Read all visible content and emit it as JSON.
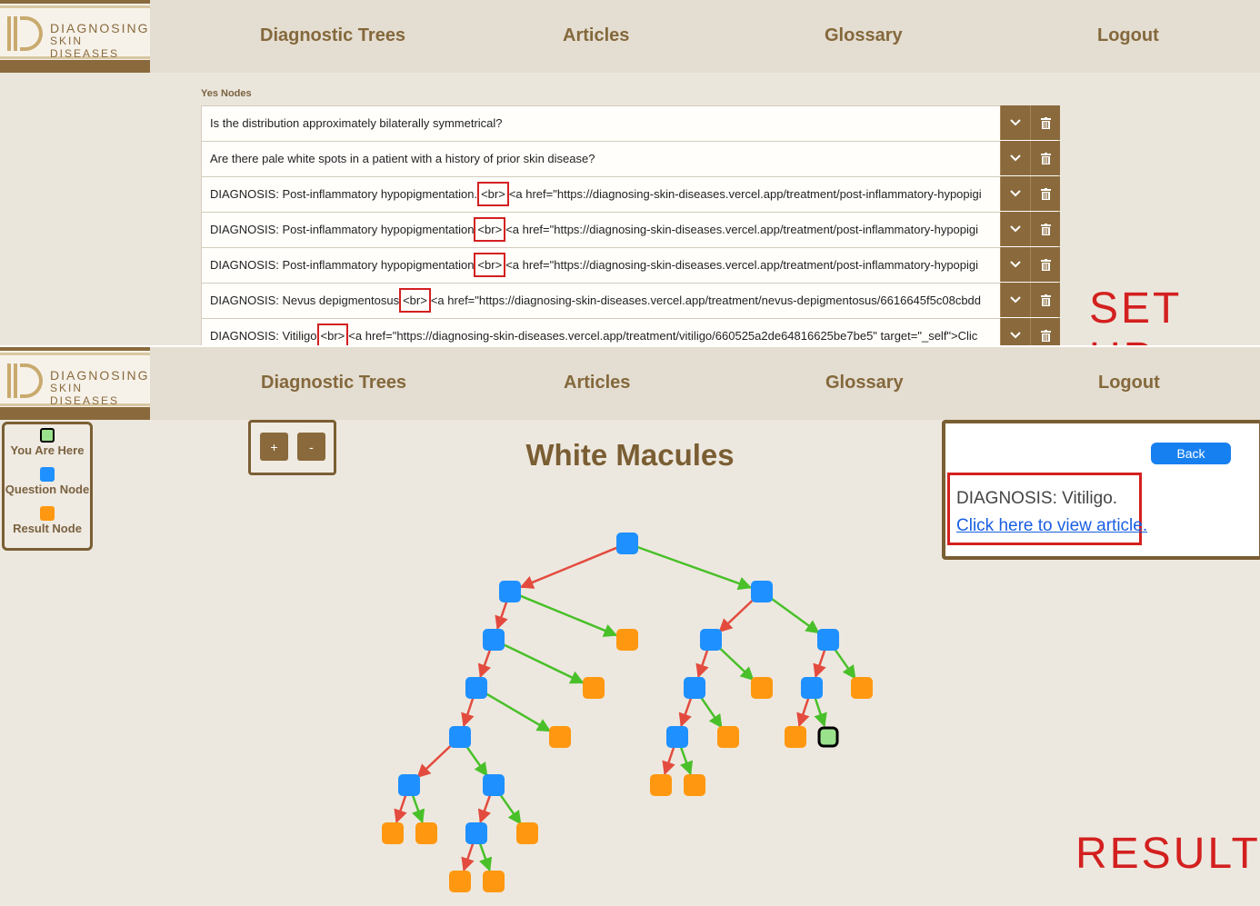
{
  "navbar": {
    "logo_line1": "DIAGNOSING",
    "logo_line2": "SKIN DISEASES",
    "items": [
      {
        "label": "Diagnostic Trees"
      },
      {
        "label": "Articles"
      },
      {
        "label": "Glossary"
      },
      {
        "label": "Logout"
      }
    ]
  },
  "setup": {
    "section_label": "Yes Nodes",
    "rows": [
      {
        "before": "Is the distribution approximately bilaterally symmetrical?",
        "tag": "",
        "after": ""
      },
      {
        "before": "Are there pale white spots in a patient with a history of prior skin disease?",
        "tag": "",
        "after": ""
      },
      {
        "before": "DIAGNOSIS: Post-inflammatory hypopigmentation.",
        "tag": "<br>",
        "after": "<a href=\"https://diagnosing-skin-diseases.vercel.app/treatment/post-inflammatory-hypopigi"
      },
      {
        "before": "DIAGNOSIS: Post-inflammatory hypopigmentation",
        "tag": "<br>",
        "after": "<a href=\"https://diagnosing-skin-diseases.vercel.app/treatment/post-inflammatory-hypopigi"
      },
      {
        "before": "DIAGNOSIS: Post-inflammatory hypopigmentation",
        "tag": "<br>",
        "after": "<a href=\"https://diagnosing-skin-diseases.vercel.app/treatment/post-inflammatory-hypopigi"
      },
      {
        "before": "DIAGNOSIS: Nevus depigmentosus",
        "tag": "<br>",
        "after": "<a href=\"https://diagnosing-skin-diseases.vercel.app/treatment/nevus-depigmentosus/6616645f5c08cbdd"
      },
      {
        "before": "DIAGNOSIS: Vitiligo",
        "tag": "<br>",
        "after": "<a href=\"https://diagnosing-skin-diseases.vercel.app/treatment/vitiligo/660525a2de64816625be7be5\" target=\"_self\">Clic"
      }
    ],
    "label": "SET UP"
  },
  "result": {
    "legend": [
      {
        "label": "You Are Here",
        "icon": "current-node-icon",
        "color": "#000000"
      },
      {
        "label": "Question Node",
        "icon": "question-node-icon",
        "color": "#1e90ff"
      },
      {
        "label": "Result Node",
        "icon": "result-node-icon",
        "color": "#ff9810"
      }
    ],
    "zoom_in": "+",
    "zoom_out": "-",
    "title": "White Macules",
    "back_label": "Back",
    "diagnosis": "DIAGNOSIS: Vitiligo.",
    "article_link": "Click here to view article.",
    "label": "RESULT"
  },
  "colors": {
    "accent": "#8a6a3c",
    "question": "#1e90ff",
    "result": "#ff9810",
    "no_edge": "#e34b3f",
    "yes_edge": "#49c02a",
    "highlight": "#d3201f"
  }
}
